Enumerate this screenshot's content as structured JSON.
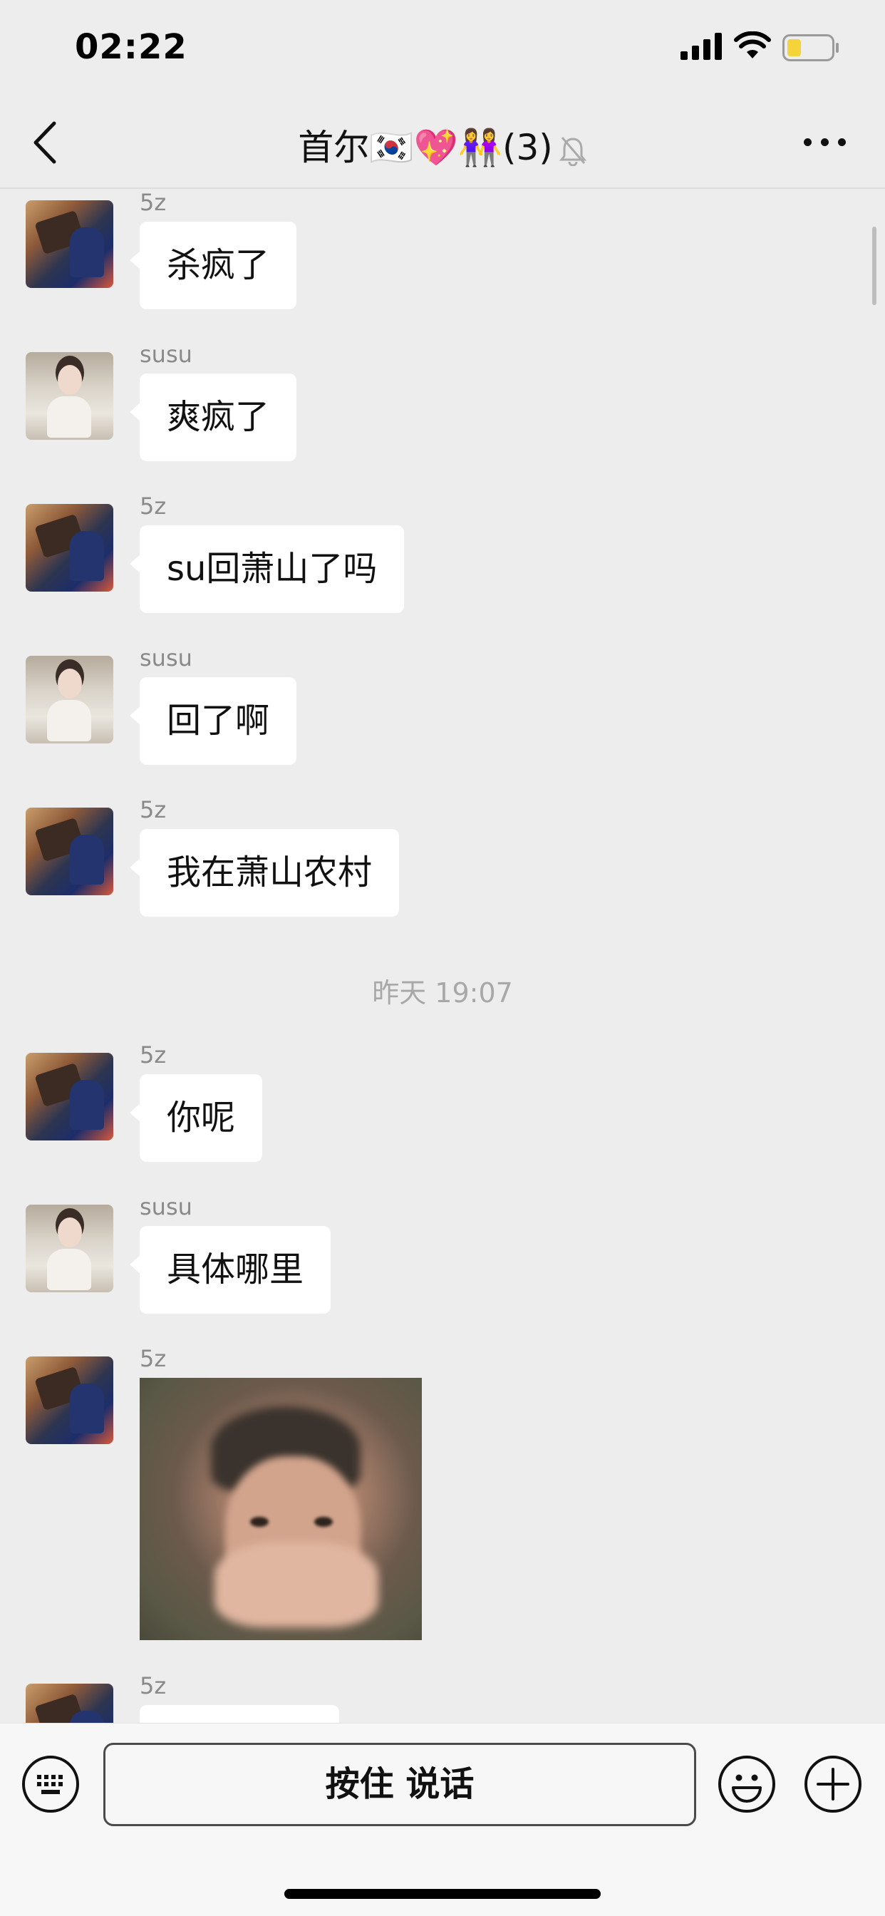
{
  "status_bar": {
    "time": "02:22"
  },
  "nav": {
    "title": "首尔🇰🇷💖👭(3)"
  },
  "messages": [
    {
      "sender": "5z",
      "text": "杀疯了",
      "avatar": "5z"
    },
    {
      "sender": "susu",
      "text": "爽疯了",
      "avatar": "susu"
    },
    {
      "sender": "5z",
      "text": "su回萧山了吗",
      "avatar": "5z"
    },
    {
      "sender": "susu",
      "text": "回了啊",
      "avatar": "susu"
    },
    {
      "sender": "5z",
      "text": "我在萧山农村",
      "avatar": "5z"
    },
    {
      "sender": "5z",
      "text": "你呢",
      "avatar": "5z"
    },
    {
      "sender": "susu",
      "text": "具体哪里",
      "avatar": "susu"
    },
    {
      "sender": "5z",
      "type": "image",
      "avatar": "5z"
    },
    {
      "sender": "5z",
      "text": "",
      "avatar": "5z"
    }
  ],
  "time_divider": "昨天 19:07",
  "input_bar": {
    "voice_label": "按住 说话"
  },
  "icons": {
    "back": "chevron-left-icon",
    "mute": "bell-slash-icon",
    "more": "more-dots-icon",
    "keyboard": "keyboard-icon",
    "emoji": "smiley-icon",
    "plus": "plus-circle-icon"
  },
  "colors": {
    "background": "#EDEDED",
    "bubble": "#FFFFFF",
    "battery_fill": "#F5D33A"
  }
}
